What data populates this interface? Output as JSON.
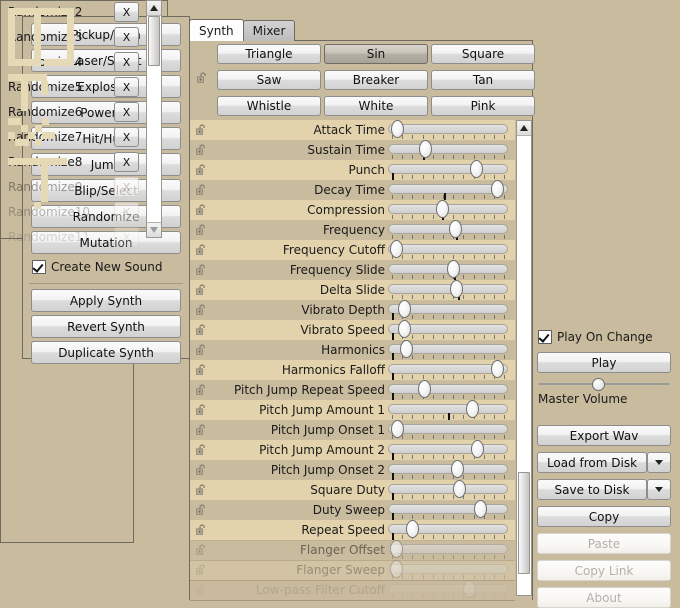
{
  "colors": {
    "background": "#c9bb9e",
    "panel_border": "#6e6a60",
    "row_light": "#e3d3ad",
    "row_dark": "#c9bb9e",
    "art_fill": "#e6d9b6",
    "active_tab": "#fdfdfd"
  },
  "generators": {
    "buttons": [
      {
        "label": "Pickup/Coin"
      },
      {
        "label": "Laser/Shoot"
      },
      {
        "label": "Explosion"
      },
      {
        "label": "Powerup"
      },
      {
        "label": "Hit/Hurt"
      },
      {
        "label": "Jump"
      },
      {
        "label": "Blip/Select"
      },
      {
        "label": "Randomize"
      },
      {
        "label": "Mutation"
      }
    ],
    "create_new_sound": {
      "label": "Create New Sound",
      "checked": true
    },
    "actions": [
      {
        "label": "Apply Synth"
      },
      {
        "label": "Revert Synth"
      },
      {
        "label": "Duplicate Synth"
      }
    ]
  },
  "sound_list": {
    "remove_label": "X",
    "items": [
      {
        "label": "Randomize2",
        "dim": false
      },
      {
        "label": "Randomize3",
        "dim": false
      },
      {
        "label": "Randomize4",
        "dim": false
      },
      {
        "label": "Randomize5",
        "dim": false
      },
      {
        "label": "Randomize6",
        "dim": false
      },
      {
        "label": "Randomize7",
        "dim": false
      },
      {
        "label": "Randomize8",
        "dim": false
      },
      {
        "label": "Randomize9",
        "dim": true
      },
      {
        "label": "Randomize10",
        "dim": true
      },
      {
        "label": "Randomize11",
        "dim": true
      }
    ],
    "scroll_thumb_pct": 8
  },
  "tabs": [
    {
      "label": "Synth",
      "active": true
    },
    {
      "label": "Mixer",
      "active": false
    }
  ],
  "wave_types": {
    "selected": "Sin",
    "buttons": [
      {
        "label": "Triangle"
      },
      {
        "label": "Sin"
      },
      {
        "label": "Square"
      },
      {
        "label": "Saw"
      },
      {
        "label": "Breaker"
      },
      {
        "label": "Tan"
      },
      {
        "label": "Whistle"
      },
      {
        "label": "White"
      },
      {
        "label": "Pink"
      }
    ]
  },
  "parameters": [
    {
      "label": "Attack Time",
      "value": 3,
      "marker": null,
      "dim": 0
    },
    {
      "label": "Sustain Time",
      "value": 29,
      "marker": 29,
      "dim": 0
    },
    {
      "label": "Punch",
      "value": 77,
      "marker": 3,
      "dim": 0
    },
    {
      "label": "Decay Time",
      "value": 96,
      "marker": 47,
      "dim": 0
    },
    {
      "label": "Compression",
      "value": 45,
      "marker": 45,
      "dim": 0
    },
    {
      "label": "Frequency",
      "value": 57,
      "marker": 57,
      "dim": 0
    },
    {
      "label": "Frequency Cutoff",
      "value": 2,
      "marker": null,
      "dim": 0
    },
    {
      "label": "Frequency Slide",
      "value": 55,
      "marker": 55,
      "dim": 0
    },
    {
      "label": "Delta Slide",
      "value": 58,
      "marker": 58,
      "dim": 0
    },
    {
      "label": "Vibrato Depth",
      "value": 9,
      "marker": 3,
      "dim": 0
    },
    {
      "label": "Vibrato Speed",
      "value": 9,
      "marker": 3,
      "dim": 0
    },
    {
      "label": "Harmonics",
      "value": 11,
      "marker": 3,
      "dim": 0
    },
    {
      "label": "Harmonics Falloff",
      "value": 96,
      "marker": 3,
      "dim": 0
    },
    {
      "label": "Pitch Jump Repeat Speed",
      "value": 28,
      "marker": 3,
      "dim": 0
    },
    {
      "label": "Pitch Jump Amount 1",
      "value": 73,
      "marker": 50,
      "dim": 0
    },
    {
      "label": "Pitch Jump Onset 1",
      "value": 3,
      "marker": null,
      "dim": 0
    },
    {
      "label": "Pitch Jump Amount 2",
      "value": 78,
      "marker": 3,
      "dim": 0
    },
    {
      "label": "Pitch Jump Onset 2",
      "value": 59,
      "marker": 3,
      "dim": 0
    },
    {
      "label": "Square Duty",
      "value": 61,
      "marker": 3,
      "dim": 0
    },
    {
      "label": "Duty Sweep",
      "value": 80,
      "marker": 3,
      "dim": 0
    },
    {
      "label": "Repeat Speed",
      "value": 17,
      "marker": 3,
      "dim": 0
    },
    {
      "label": "Flanger Offset",
      "value": 2,
      "marker": null,
      "dim": 1
    },
    {
      "label": "Flanger Sweep",
      "value": 2,
      "marker": null,
      "dim": 2
    },
    {
      "label": "Low-pass Filter Cutoff",
      "value": 70,
      "marker": null,
      "dim": 3
    }
  ],
  "param_scroll": {
    "thumb_top_pct": 73,
    "thumb_height_pct": 22
  },
  "playback": {
    "play_on_change": {
      "label": "Play On Change",
      "checked": true
    },
    "play_label": "Play",
    "master_volume": {
      "label": "Master Volume",
      "value": 45
    }
  },
  "file_actions": [
    {
      "label": "Export Wav",
      "type": "plain",
      "disabled": false
    },
    {
      "label": "Load from Disk",
      "type": "split",
      "disabled": false
    },
    {
      "label": "Save to Disk",
      "type": "split",
      "disabled": false
    },
    {
      "label": "Copy",
      "type": "plain",
      "disabled": false
    },
    {
      "label": "Paste",
      "type": "plain",
      "disabled": true
    },
    {
      "label": "Copy Link",
      "type": "plain",
      "disabled": true
    },
    {
      "label": "About",
      "type": "plain",
      "disabled": true
    }
  ],
  "icons": {
    "lock": "unlocked-padlock-icon",
    "dropdown": "chevron-down-icon",
    "scroll_up": "scroll-up-arrow-icon"
  },
  "art_blocks": [
    [
      0,
      0,
      66,
      7
    ],
    [
      0,
      7,
      7,
      44
    ],
    [
      26,
      7,
      7,
      44
    ],
    [
      59,
      7,
      7,
      44
    ],
    [
      0,
      51,
      33,
      7
    ],
    [
      36,
      51,
      30,
      7
    ],
    [
      0,
      66,
      39,
      7
    ],
    [
      13,
      73,
      7,
      30
    ],
    [
      33,
      73,
      7,
      14
    ],
    [
      0,
      110,
      13,
      7
    ],
    [
      13,
      117,
      7,
      7
    ],
    [
      20,
      124,
      7,
      7
    ],
    [
      27,
      117,
      7,
      7
    ],
    [
      34,
      110,
      7,
      7
    ],
    [
      0,
      124,
      7,
      7
    ],
    [
      7,
      131,
      14,
      7
    ],
    [
      27,
      131,
      7,
      7
    ],
    [
      34,
      124,
      13,
      7
    ],
    [
      0,
      150,
      59,
      7
    ],
    [
      33,
      157,
      7,
      30
    ],
    [
      33,
      187,
      7,
      7
    ],
    [
      26,
      194,
      7,
      7
    ]
  ]
}
